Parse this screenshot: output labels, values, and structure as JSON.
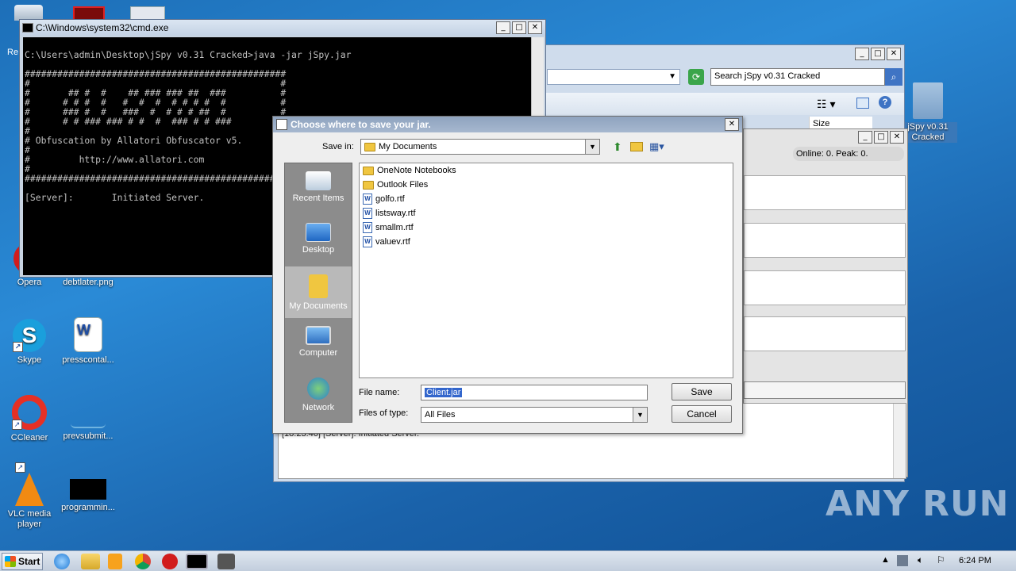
{
  "desktop": {
    "icons": [
      {
        "label": "Opera"
      },
      {
        "label": "debtlater.png"
      },
      {
        "label": "Skype"
      },
      {
        "label": "presscontal..."
      },
      {
        "label": "CCleaner"
      },
      {
        "label": "prevsubmit..."
      },
      {
        "label": "VLC media player"
      },
      {
        "label": "programmin..."
      },
      {
        "label": "jSpy v0.31 Cracked"
      }
    ],
    "partial_labels": [
      "Re",
      "F",
      "C",
      "c"
    ]
  },
  "cmd": {
    "title": "C:\\Windows\\system32\\cmd.exe",
    "lines": [
      "",
      "C:\\Users\\admin\\Desktop\\jSpy v0.31 Cracked>java -jar jSpy.jar",
      "",
      "################################################",
      "#                                              #",
      "#       ## #  #    ## ### ### ##  ###          #",
      "#      # # #  #   #  #  #  # # # #  #          #",
      "#      ### #  #   ###  #  # # # ##  #          #",
      "#      # # ### ### # #  #  ### # # ###         #",
      "#",
      "# Obfuscation by Allatori Obfuscator v5.",
      "#",
      "#         http://www.allatori.com",
      "#",
      "################################################",
      "",
      "[Server]:       Initiated Server."
    ]
  },
  "explorer": {
    "search_placeholder": "Search jSpy v0.31 Cracked",
    "column_size": "Size"
  },
  "jspy": {
    "status": "Online: 0. Peak: 0.",
    "log_line": "[18:23:46]  [Server]: Initiated Server."
  },
  "dialog": {
    "title": "Choose where to save your jar.",
    "save_in_label": "Save in:",
    "save_in_value": "My Documents",
    "places": [
      {
        "label": "Recent Items",
        "icon": "recent-items-icon"
      },
      {
        "label": "Desktop",
        "icon": "desktop-icon"
      },
      {
        "label": "My Documents",
        "icon": "my-documents-icon"
      },
      {
        "label": "Computer",
        "icon": "computer-icon"
      },
      {
        "label": "Network",
        "icon": "network-icon"
      }
    ],
    "files": [
      {
        "name": "OneNote Notebooks",
        "type": "folder"
      },
      {
        "name": "Outlook Files",
        "type": "folder"
      },
      {
        "name": "golfo.rtf",
        "type": "rtf"
      },
      {
        "name": "listsway.rtf",
        "type": "rtf"
      },
      {
        "name": "smallm.rtf",
        "type": "rtf"
      },
      {
        "name": "valuev.rtf",
        "type": "rtf"
      }
    ],
    "file_name_label": "File name:",
    "file_name_value": "Client.jar",
    "files_of_type_label": "Files of type:",
    "files_of_type_value": "All Files",
    "save_button": "Save",
    "cancel_button": "Cancel"
  },
  "taskbar": {
    "start_label": "Start",
    "clock": "6:24 PM"
  },
  "watermark": "ANY RUN"
}
